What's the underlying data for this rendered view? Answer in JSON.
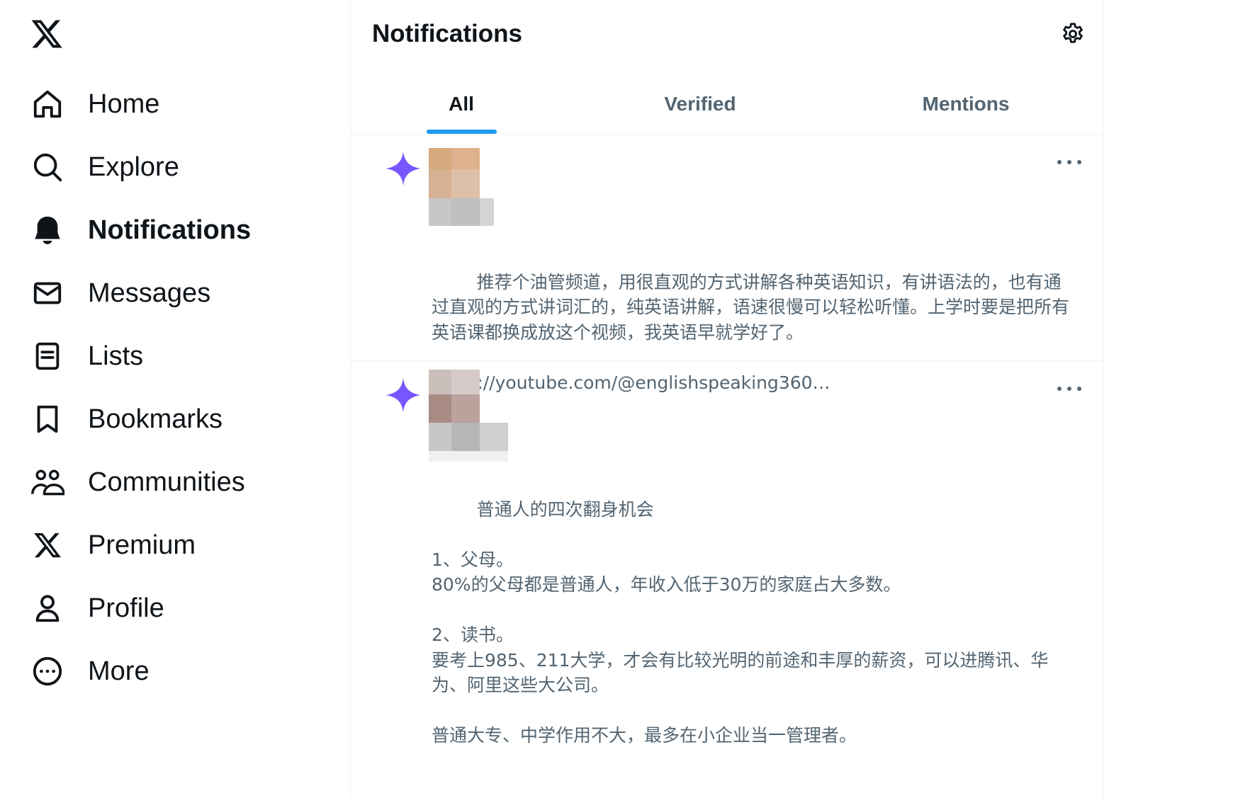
{
  "sidebar": {
    "logo_icon": "x-logo-icon",
    "items": [
      {
        "label": "Home",
        "icon": "home-icon"
      },
      {
        "label": "Explore",
        "icon": "search-icon"
      },
      {
        "label": "Notifications",
        "icon": "bell-icon",
        "active": true
      },
      {
        "label": "Messages",
        "icon": "envelope-icon"
      },
      {
        "label": "Lists",
        "icon": "list-icon"
      },
      {
        "label": "Bookmarks",
        "icon": "bookmark-icon"
      },
      {
        "label": "Communities",
        "icon": "communities-icon"
      },
      {
        "label": "Premium",
        "icon": "x-logo-icon"
      },
      {
        "label": "Profile",
        "icon": "profile-icon"
      },
      {
        "label": "More",
        "icon": "more-circle-icon"
      }
    ]
  },
  "header": {
    "title": "Notifications",
    "settings_icon": "gear-icon"
  },
  "tabs": [
    {
      "label": "All",
      "active": true
    },
    {
      "label": "Verified",
      "active": false
    },
    {
      "label": "Mentions",
      "active": false
    }
  ],
  "notifications": [
    {
      "icon": "sparkle-icon",
      "text": "推荐个油管频道，用很直观的方式讲解各种英语知识，有讲语法的，也有通过直观的方式讲词汇的，纯英语讲解，语速很慢可以轻松听懂。上学时要是把所有英语课都换成放这个视频，我英语早就学好了。",
      "link": "https://youtube.com/@englishspeaking360…"
    },
    {
      "icon": "sparkle-icon",
      "text": "普通人的四次翻身机会\n\n1、父母。\n80%的父母都是普通人，年收入低于30万的家庭占大多数。\n\n2、读书。\n要考上985、211大学，才会有比较光明的前途和丰厚的薪资，可以进腾讯、华为、阿里这些大公司。\n\n普通大专、中学作用不大，最多在小企业当一管理者。"
    }
  ],
  "colors": {
    "accent": "#1d9bf0",
    "sparkle": "#7856ff",
    "text_primary": "#0f1419",
    "text_secondary": "#536471",
    "divider": "#eff3f4"
  }
}
